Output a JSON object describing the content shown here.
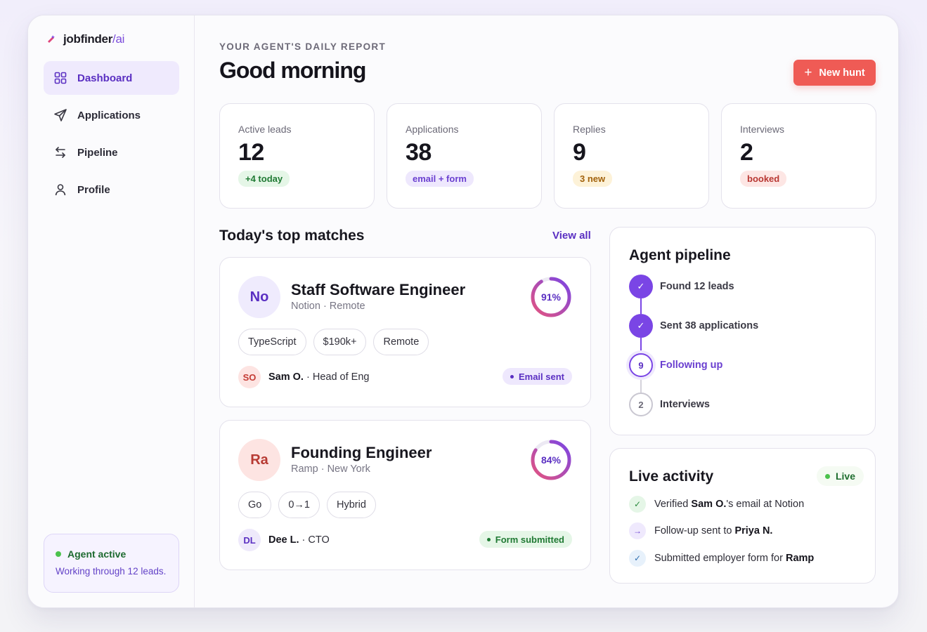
{
  "app": {
    "name": "jobfinder",
    "name_suffix": "/ai"
  },
  "sidebar": {
    "items": [
      {
        "label": "Dashboard",
        "icon": "dashboard-icon",
        "active": true
      },
      {
        "label": "Applications",
        "icon": "send-icon"
      },
      {
        "label": "Pipeline",
        "icon": "arrows-icon"
      },
      {
        "label": "Profile",
        "icon": "user-icon"
      }
    ],
    "agent_status": {
      "title": "Agent active",
      "detail": "Working through 12 leads."
    }
  },
  "header": {
    "eyebrow": "YOUR AGENT'S DAILY REPORT",
    "title": "Good morning",
    "new_button": "New hunt"
  },
  "stats": [
    {
      "label": "Active leads",
      "value": "12",
      "badge": "+4 today",
      "badge_color": "green"
    },
    {
      "label": "Applications",
      "value": "38",
      "badge": "email + form",
      "badge_color": "purple"
    },
    {
      "label": "Replies",
      "value": "9",
      "badge": "3 new",
      "badge_color": "amber"
    },
    {
      "label": "Interviews",
      "value": "2",
      "badge": "booked",
      "badge_color": "red"
    }
  ],
  "matches": {
    "title": "Today's top matches",
    "view_all": "View all",
    "items": [
      {
        "initials": "No",
        "role": "Staff Software Engineer",
        "company": "Notion · Remote",
        "match_pct": 91,
        "match_label": "91%",
        "tags": [
          "TypeScript",
          "$190k+",
          "Remote"
        ],
        "contact_initials": "SO",
        "contact_name": "Sam O.",
        "contact_title": " · Head of Eng",
        "status": "Email sent"
      },
      {
        "initials": "Ra",
        "role": "Founding Engineer",
        "company": "Ramp · New York",
        "match_pct": 84,
        "match_label": "84%",
        "tags": [
          "Go",
          "0→1",
          "Hybrid"
        ],
        "contact_initials": "DL",
        "contact_name": "Dee L.",
        "contact_title": " · CTO",
        "status": "Form submitted"
      }
    ]
  },
  "pipeline": {
    "title": "Agent pipeline",
    "steps": [
      {
        "marker": "✓",
        "label": "Found 12 leads",
        "state": "done"
      },
      {
        "marker": "✓",
        "label": "Sent 38 applications",
        "state": "done"
      },
      {
        "marker": "9",
        "label": "Following up",
        "state": "current"
      },
      {
        "marker": "2",
        "label": "Interviews",
        "state": "todo"
      }
    ]
  },
  "activity": {
    "title": "Live activity",
    "badge": "Live",
    "items": [
      {
        "icon": "✓",
        "pre": "Verified ",
        "bold": "Sam O.",
        "post": "'s email at Notion"
      },
      {
        "icon": "→",
        "pre": "Follow-up sent to ",
        "bold": "Priya N.",
        "post": ""
      },
      {
        "icon": "✓",
        "pre": "Submitted employer form for ",
        "bold": "Ramp",
        "post": ""
      }
    ]
  },
  "colors": {
    "accent": "#7a45e5",
    "primary_button": "#ef5b55",
    "live_green": "#4cc24d"
  }
}
